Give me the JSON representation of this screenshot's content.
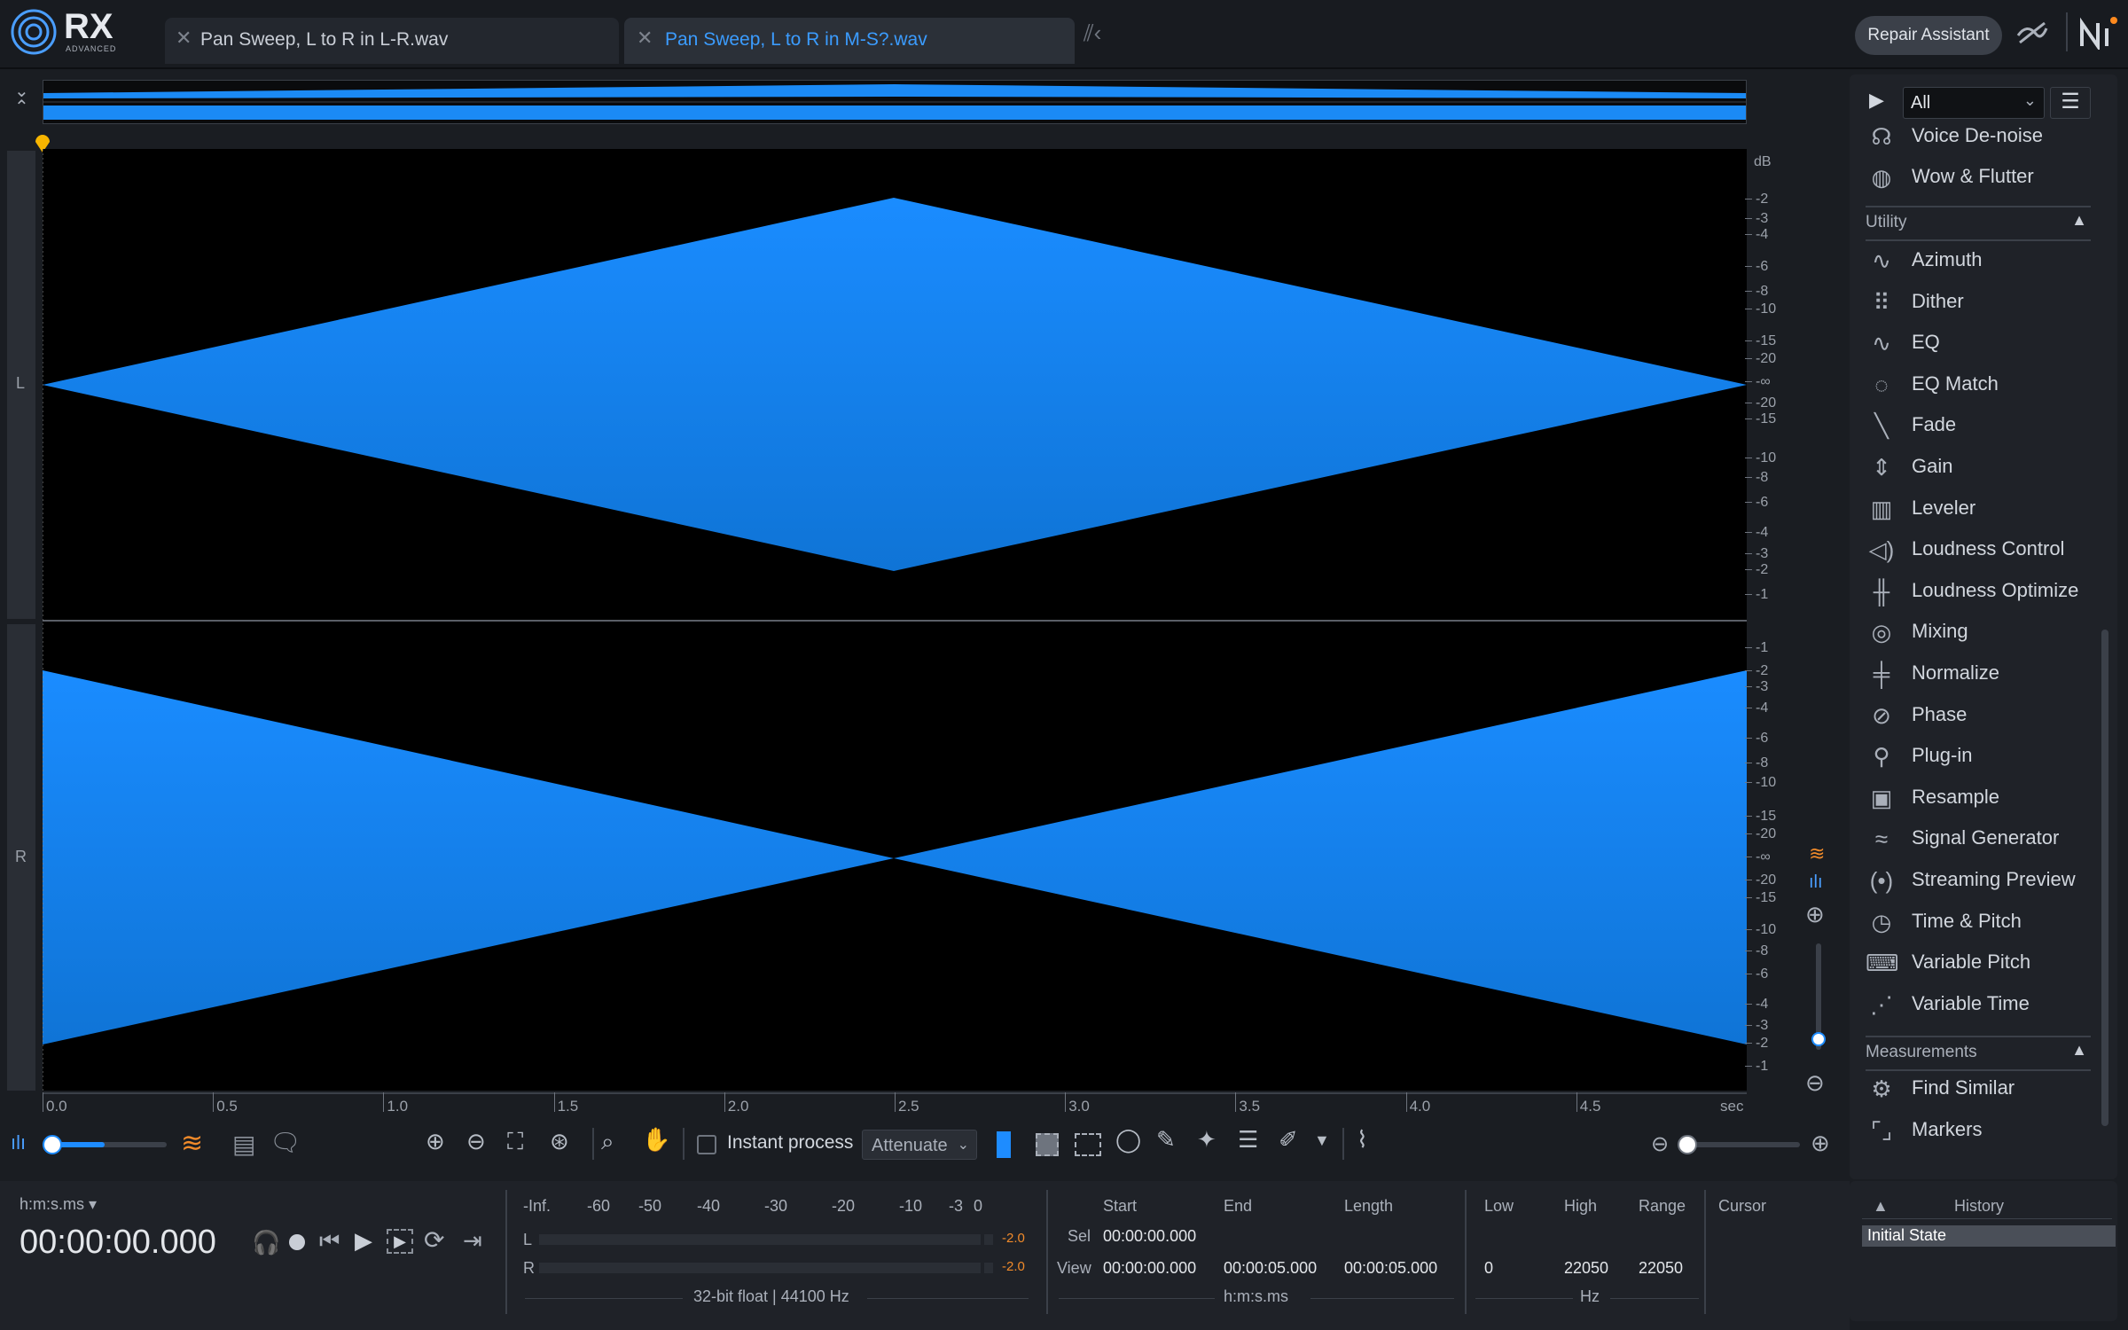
{
  "app": {
    "logo": "RX",
    "logo_sub": "ADVANCED",
    "tabs": [
      {
        "label": "Pan Sweep, L to R in L-R.wav",
        "active": false
      },
      {
        "label": "Pan Sweep, L to R in M-S?.wav",
        "active": true
      }
    ],
    "repair_button": "Repair Assistant"
  },
  "colors": {
    "accent": "#1e8cff",
    "waveform": "#1b8af5",
    "marker": "#f7b500"
  },
  "waveform": {
    "channels": [
      "L",
      "R"
    ],
    "db_unit": "dB",
    "db_ticks_top": [
      "-2",
      "-3",
      "-4",
      "-6",
      "-8",
      "-10",
      "-15",
      "-20",
      "-∞",
      "-20",
      "-15",
      "-10",
      "-8",
      "-6",
      "-4",
      "-3",
      "-2",
      "-1"
    ],
    "db_ticks_bottom": [
      "-1",
      "-2",
      "-3",
      "-4",
      "-6",
      "-8",
      "-10",
      "-15",
      "-20",
      "-∞",
      "-20",
      "-15",
      "-10",
      "-8",
      "-6",
      "-4",
      "-3",
      "-2",
      "-1"
    ],
    "time_ticks": [
      "0.0",
      "0.5",
      "1.0",
      "1.5",
      "2.0",
      "2.5",
      "3.0",
      "3.5",
      "4.0",
      "4.5"
    ],
    "time_unit": "sec"
  },
  "toolbar": {
    "instant_process_label": "Instant process",
    "instant_process_checked": false,
    "mode_select": "Attenuate"
  },
  "modules": {
    "filter": "All",
    "top_items": [
      {
        "label": "Voice De-noise",
        "icon": "voice-denoise-icon"
      },
      {
        "label": "Wow & Flutter",
        "icon": "wow-flutter-icon"
      }
    ],
    "utility_header": "Utility",
    "utility_items": [
      {
        "label": "Azimuth",
        "icon": "azimuth-icon"
      },
      {
        "label": "Dither",
        "icon": "dither-icon"
      },
      {
        "label": "EQ",
        "icon": "eq-icon"
      },
      {
        "label": "EQ Match",
        "icon": "eq-match-icon"
      },
      {
        "label": "Fade",
        "icon": "fade-icon"
      },
      {
        "label": "Gain",
        "icon": "gain-icon"
      },
      {
        "label": "Leveler",
        "icon": "leveler-icon"
      },
      {
        "label": "Loudness Control",
        "icon": "loudness-control-icon"
      },
      {
        "label": "Loudness Optimize",
        "icon": "loudness-optimize-icon"
      },
      {
        "label": "Mixing",
        "icon": "mixing-icon"
      },
      {
        "label": "Normalize",
        "icon": "normalize-icon"
      },
      {
        "label": "Phase",
        "icon": "phase-icon"
      },
      {
        "label": "Plug-in",
        "icon": "plugin-icon"
      },
      {
        "label": "Resample",
        "icon": "resample-icon"
      },
      {
        "label": "Signal Generator",
        "icon": "signal-generator-icon"
      },
      {
        "label": "Streaming Preview",
        "icon": "streaming-preview-icon"
      },
      {
        "label": "Time & Pitch",
        "icon": "time-pitch-icon"
      },
      {
        "label": "Variable Pitch",
        "icon": "variable-pitch-icon"
      },
      {
        "label": "Variable Time",
        "icon": "variable-time-icon"
      }
    ],
    "measurements_header": "Measurements",
    "measurement_items": [
      {
        "label": "Find Similar",
        "icon": "find-similar-icon"
      },
      {
        "label": "Markers",
        "icon": "markers-icon"
      }
    ]
  },
  "transport": {
    "time_format": "h:m:s.ms",
    "time_display": "00:00:00.000"
  },
  "meter": {
    "scale": [
      "-Inf.",
      "-60",
      "-50",
      "-40",
      "-30",
      "-20",
      "-10",
      "-3",
      "0"
    ],
    "channels": [
      {
        "name": "L",
        "peak": "-2.0"
      },
      {
        "name": "R",
        "peak": "-2.0"
      }
    ],
    "format": "32-bit float | 44100 Hz"
  },
  "selection": {
    "headers": {
      "start": "Start",
      "end": "End",
      "length": "Length",
      "low": "Low",
      "high": "High",
      "range": "Range",
      "cursor": "Cursor"
    },
    "sel": {
      "label": "Sel",
      "start": "00:00:00.000"
    },
    "view": {
      "label": "View",
      "start": "00:00:00.000",
      "end": "00:00:05.000",
      "length": "00:00:05.000",
      "low": "0",
      "high": "22050",
      "range": "22050"
    },
    "time_unit": "h:m:s.ms",
    "freq_unit": "Hz"
  },
  "history": {
    "title": "History",
    "items": [
      "Initial State"
    ]
  }
}
